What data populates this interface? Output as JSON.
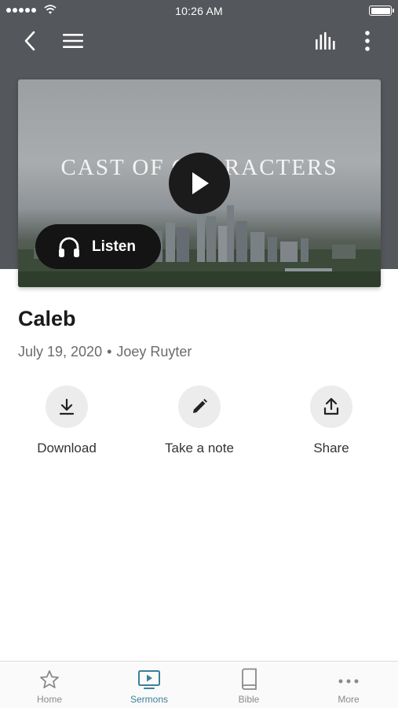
{
  "status_bar": {
    "time": "10:26 AM"
  },
  "nav": {
    "back": "back-icon",
    "menu": "menu-icon",
    "audio": "equalizer-icon",
    "more": "more-vertical-icon"
  },
  "video": {
    "overlay_title": "CAST OF CHARACTERS",
    "listen_label": "Listen"
  },
  "sermon": {
    "title": "Caleb",
    "date": "July 19, 2020",
    "separator": "•",
    "speaker": "Joey Ruyter"
  },
  "actions": [
    {
      "label": "Download",
      "icon": "download-icon"
    },
    {
      "label": "Take a note",
      "icon": "pencil-icon"
    },
    {
      "label": "Share",
      "icon": "share-icon"
    }
  ],
  "tabs": [
    {
      "label": "Home",
      "icon": "star-icon"
    },
    {
      "label": "Sermons",
      "icon": "tv-play-icon",
      "active": true
    },
    {
      "label": "Bible",
      "icon": "book-icon"
    },
    {
      "label": "More",
      "icon": "more-horizontal-icon"
    }
  ],
  "colors": {
    "header": "#54575b",
    "accent": "#3d7f9a",
    "button_bg": "#ececec"
  }
}
